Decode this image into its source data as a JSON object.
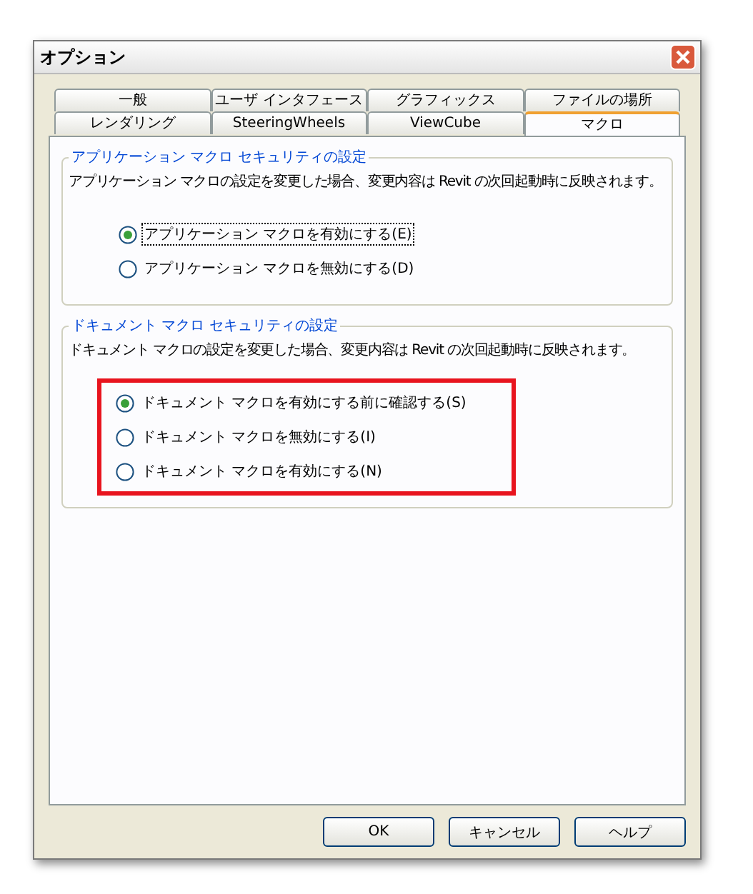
{
  "window": {
    "title": "オプション"
  },
  "tab_rows": [
    [
      {
        "label": "一般",
        "selected": false
      },
      {
        "label": "ユーザ インタフェース",
        "selected": false
      },
      {
        "label": "グラフィックス",
        "selected": false
      },
      {
        "label": "ファイルの場所",
        "selected": false
      }
    ],
    [
      {
        "label": "レンダリング",
        "selected": false
      },
      {
        "label": "SteeringWheels",
        "selected": false
      },
      {
        "label": "ViewCube",
        "selected": false
      },
      {
        "label": "マクロ",
        "selected": true
      }
    ]
  ],
  "groups": [
    {
      "title": "アプリケーション マクロ セキュリティの設定",
      "description": "アプリケーション マクロの設定を変更した場合、変更内容は Revit の次回起動時に反映されます。",
      "highlighted": false,
      "options": [
        {
          "label": "アプリケーション マクロを有効にする(E)",
          "selected": true,
          "focused": true
        },
        {
          "label": "アプリケーション マクロを無効にする(D)",
          "selected": false,
          "focused": false
        }
      ]
    },
    {
      "title": "ドキュメント マクロ セキュリティの設定",
      "description": "ドキュメント マクロの設定を変更した場合、変更内容は Revit の次回起動時に反映されます。",
      "highlighted": true,
      "options": [
        {
          "label": "ドキュメント マクロを有効にする前に確認する(S)",
          "selected": true,
          "focused": false
        },
        {
          "label": "ドキュメント マクロを無効にする(I)",
          "selected": false,
          "focused": false
        },
        {
          "label": "ドキュメント マクロを有効にする(N)",
          "selected": false,
          "focused": false
        }
      ]
    }
  ],
  "buttons": [
    "OK",
    "キャンセル",
    "ヘルプ"
  ]
}
